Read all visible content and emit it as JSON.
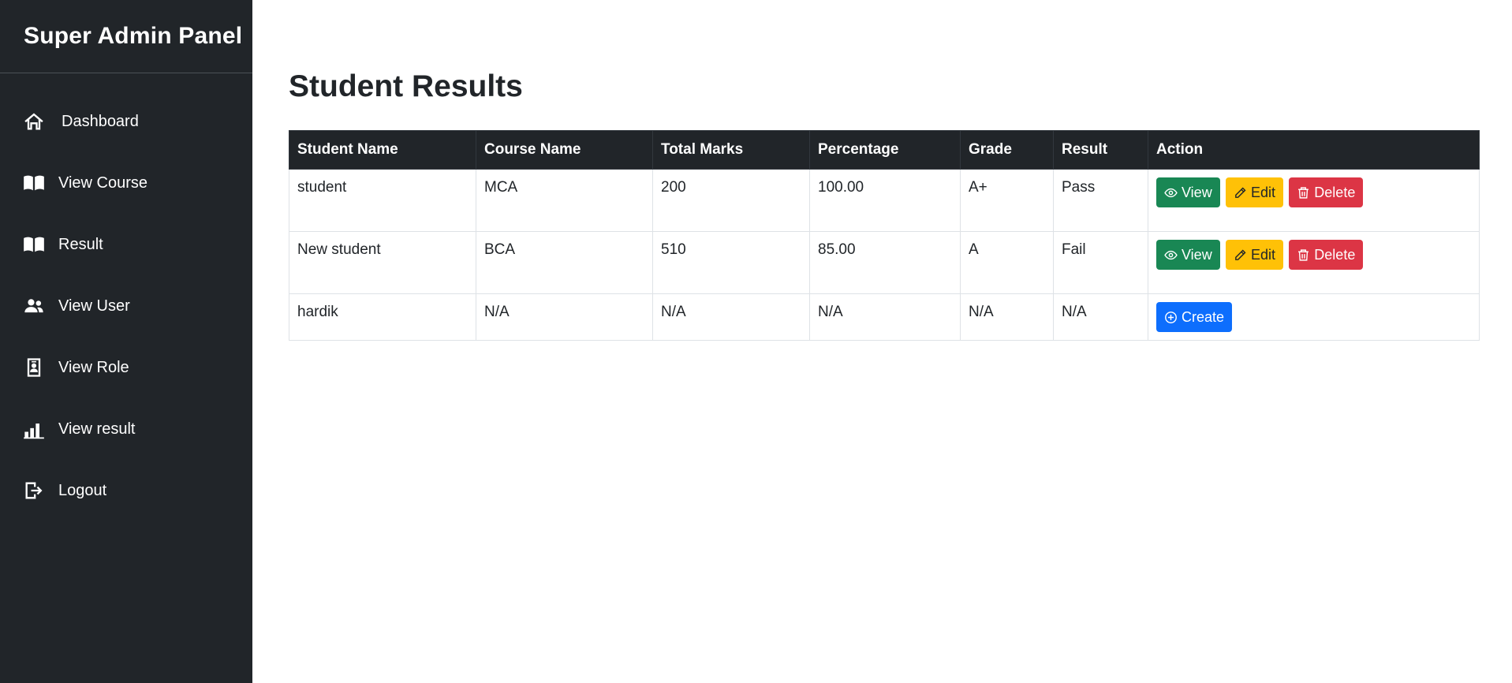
{
  "sidebar": {
    "brand": "Super Admin Panel",
    "items": [
      {
        "label": "Dashboard",
        "icon": "house-icon"
      },
      {
        "label": "View Course",
        "icon": "book-icon"
      },
      {
        "label": "Result",
        "icon": "book-icon"
      },
      {
        "label": "View User",
        "icon": "users-icon"
      },
      {
        "label": "View Role",
        "icon": "id-badge-icon"
      },
      {
        "label": "View result",
        "icon": "bar-chart-icon"
      },
      {
        "label": "Logout",
        "icon": "logout-icon"
      }
    ]
  },
  "main": {
    "title": "Student Results",
    "table": {
      "headers": [
        "Student Name",
        "Course Name",
        "Total Marks",
        "Percentage",
        "Grade",
        "Result",
        "Action"
      ],
      "rows": [
        {
          "student": "student",
          "course": "MCA",
          "total": "200",
          "percentage": "100.00",
          "grade": "A+",
          "result": "Pass"
        },
        {
          "student": "New student",
          "course": "BCA",
          "total": "510",
          "percentage": "85.00",
          "grade": "A",
          "result": "Fail"
        },
        {
          "student": "hardik",
          "course": "N/A",
          "total": "N/A",
          "percentage": "N/A",
          "grade": "N/A",
          "result": "N/A"
        }
      ]
    },
    "actions": {
      "view_label": "View",
      "edit_label": "Edit",
      "delete_label": "Delete",
      "create_label": "Create"
    }
  },
  "colors": {
    "sidebar_bg": "#212529",
    "view": "#198754",
    "edit": "#ffc107",
    "delete": "#dc3545",
    "create": "#0d6efd"
  }
}
